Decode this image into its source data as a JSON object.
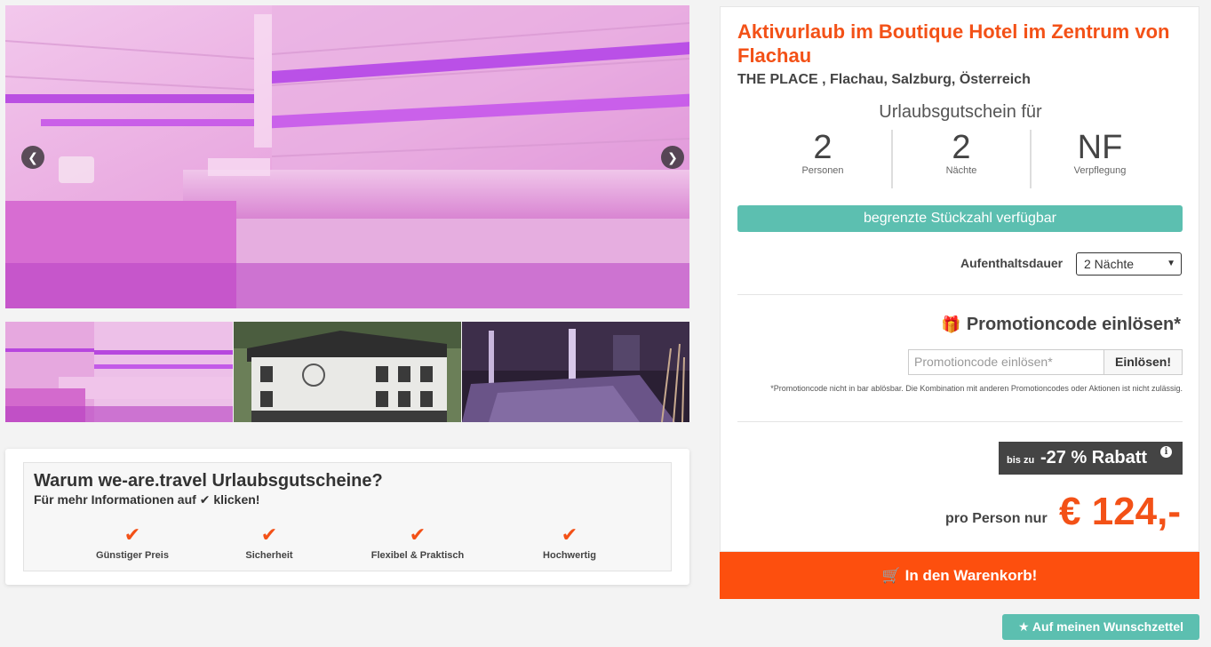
{
  "gallery": {
    "main_image": "sauna-interior-photo",
    "prev_icon": "chevron-left-icon",
    "next_icon": "chevron-right-icon",
    "thumbnails": [
      "sauna-thumbnail",
      "hotel-exterior-thumbnail",
      "hotel-bar-thumbnail"
    ]
  },
  "why": {
    "title": "Warum we-are.travel Urlaubsgutscheine?",
    "subtitle_before": "Für mehr Informationen auf",
    "subtitle_check": "✔",
    "subtitle_after": "klicken!",
    "items": [
      {
        "icon": "✔",
        "label": "Günstiger Preis"
      },
      {
        "icon": "✔",
        "label": "Sicherheit"
      },
      {
        "icon": "✔",
        "label": "Flexibel & Praktisch"
      },
      {
        "icon": "✔",
        "label": "Hochwertig"
      }
    ]
  },
  "offer": {
    "title": "Aktivurlaub im Boutique Hotel im Zentrum von Flachau",
    "location": "THE PLACE , Flachau, Salzburg, Österreich",
    "voucher_for": "Urlaubsgutschein für",
    "stats": [
      {
        "value": "2",
        "label": "Personen"
      },
      {
        "value": "2",
        "label": "Nächte"
      },
      {
        "value": "NF",
        "label": "Verpflegung"
      }
    ],
    "limited_badge": "begrenzte Stückzahl verfügbar",
    "stay_label": "Aufenthaltsdauer",
    "stay_selected": "2 Nächte",
    "promo_heading": "Promotioncode einlösen*",
    "promo_icon": "🎁",
    "promo_placeholder": "Promotioncode einlösen*",
    "promo_button": "Einlösen!",
    "promo_note": "*Promotioncode nicht in bar ablösbar. Die Kombination mit anderen Promotioncodes oder Aktionen ist nicht zulässig.",
    "discount_prefix": "bis zu",
    "discount_main": "-27 % Rabatt",
    "discount_info_icon": "i",
    "per_person": "pro Person nur",
    "price": "€ 124,-",
    "cart_button": "In den Warenkorb!",
    "cart_icon": "🛒",
    "wish_button": "Auf meinen Wunschzettel",
    "wish_icon": "★"
  },
  "colors": {
    "accent": "#f35117",
    "cart": "#fd4f0e",
    "teal": "#5cbfb0",
    "dark": "#444444"
  }
}
